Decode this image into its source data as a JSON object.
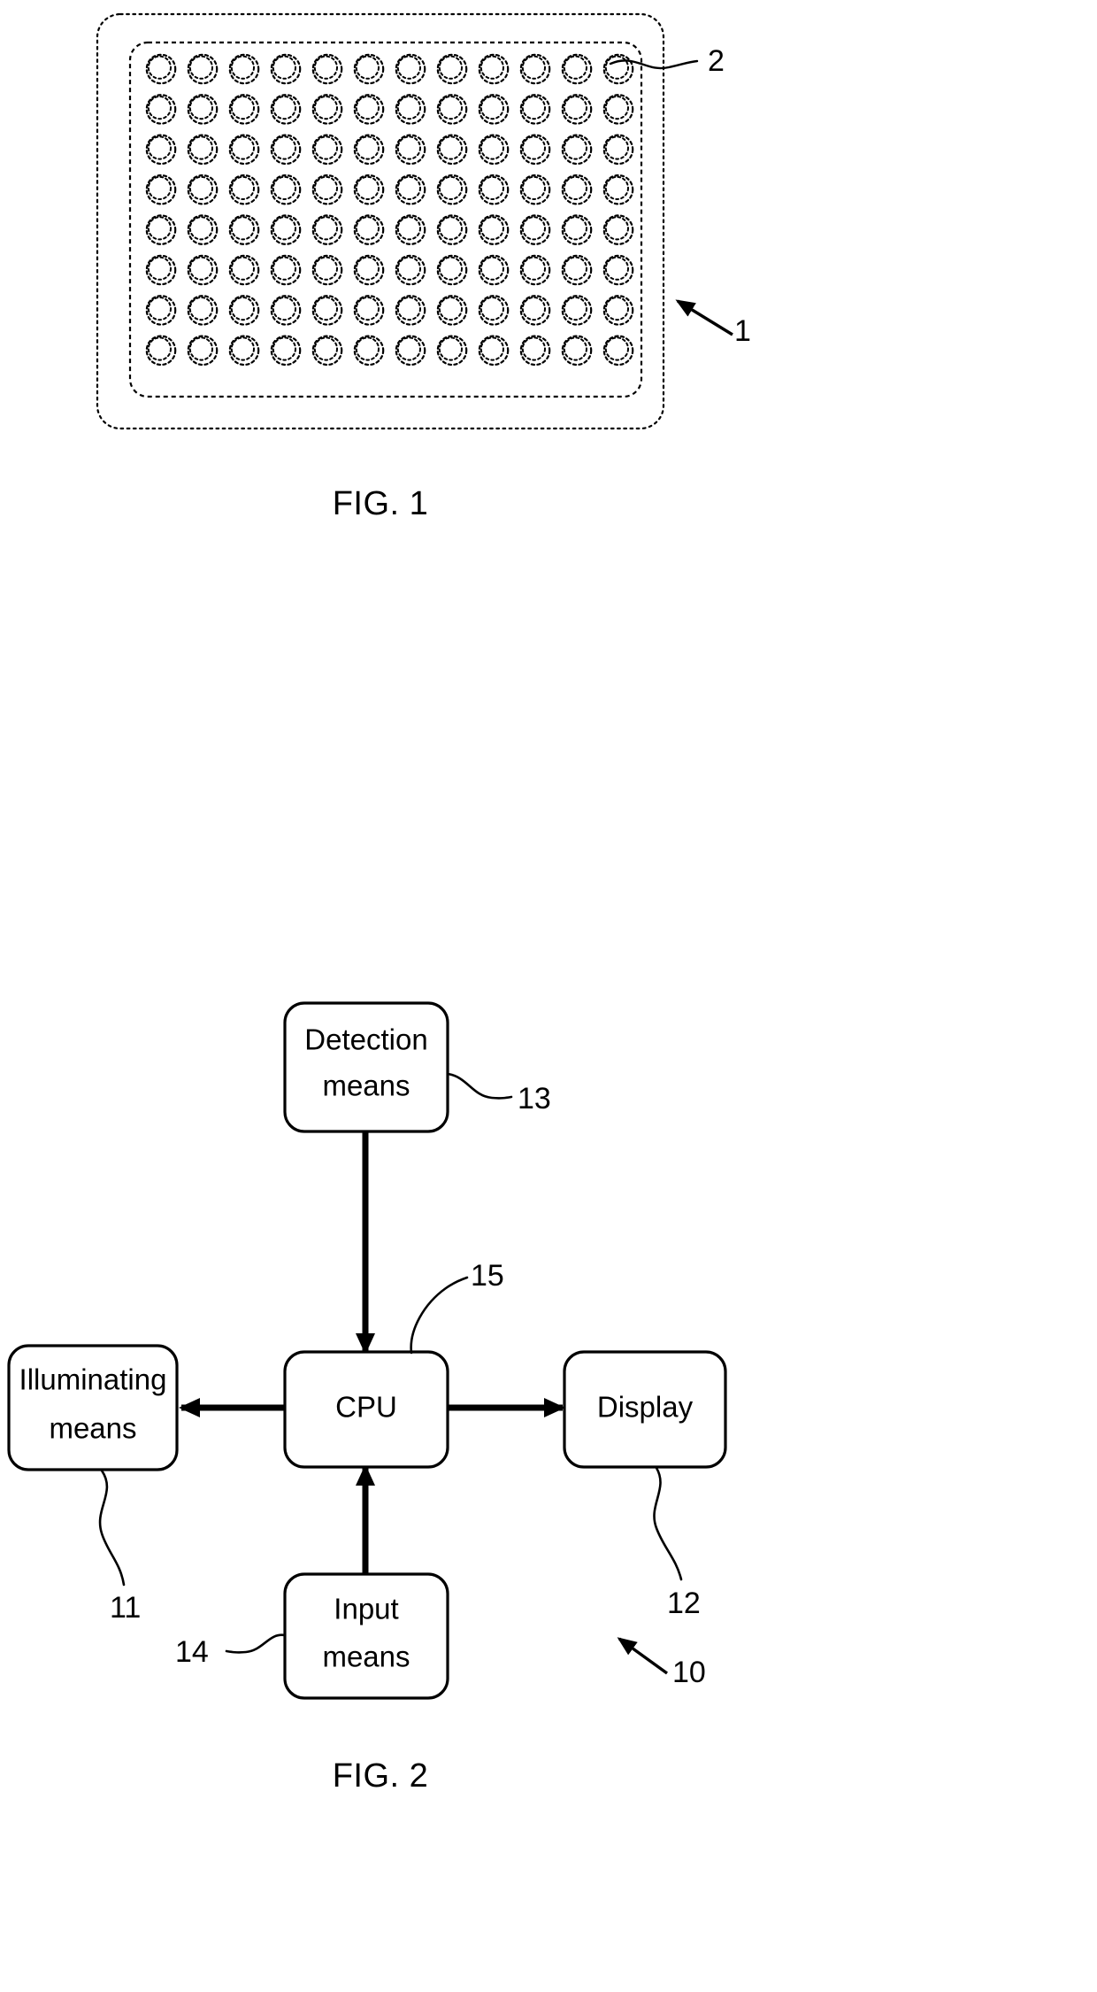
{
  "document": {
    "type": "patent-drawing-sheet",
    "background_color": "#ffffff",
    "line_color": "#000000"
  },
  "figures": [
    {
      "id": "fig1",
      "caption": "FIG. 1",
      "title": "Microplate / well plate",
      "plate": {
        "outer_border_style": "dotted",
        "inner_border_style": "dashed",
        "well_rows": 8,
        "well_columns": 12,
        "well_count": 96,
        "well_style": "double concentric dashed circle"
      },
      "reference_numerals": [
        {
          "id": "fig1-ref-2",
          "label": "2",
          "points_to": "well",
          "leader": "curved"
        },
        {
          "id": "fig1-ref-1",
          "label": "1",
          "points_to": "plate",
          "leader": "arrow"
        }
      ]
    },
    {
      "id": "fig2",
      "caption": "FIG. 2",
      "title": "System block diagram",
      "blocks": [
        {
          "id": "detection",
          "lines": [
            "Detection",
            "means"
          ],
          "ref": "13"
        },
        {
          "id": "illuminating",
          "lines": [
            "Illuminating",
            "means"
          ],
          "ref": "11"
        },
        {
          "id": "cpu",
          "lines": [
            "CPU"
          ],
          "ref": "15"
        },
        {
          "id": "display",
          "lines": [
            "Display"
          ],
          "ref": "12"
        },
        {
          "id": "input",
          "lines": [
            "Input",
            "means"
          ],
          "ref": "14"
        }
      ],
      "system_ref": {
        "label": "10",
        "leader": "arrow"
      },
      "connections": [
        {
          "from": "cpu",
          "to": "detection",
          "arrow": "double"
        },
        {
          "from": "cpu",
          "to": "illuminating",
          "arrow": "single"
        },
        {
          "from": "cpu",
          "to": "display",
          "arrow": "single"
        },
        {
          "from": "input",
          "to": "cpu",
          "arrow": "single"
        }
      ]
    }
  ]
}
